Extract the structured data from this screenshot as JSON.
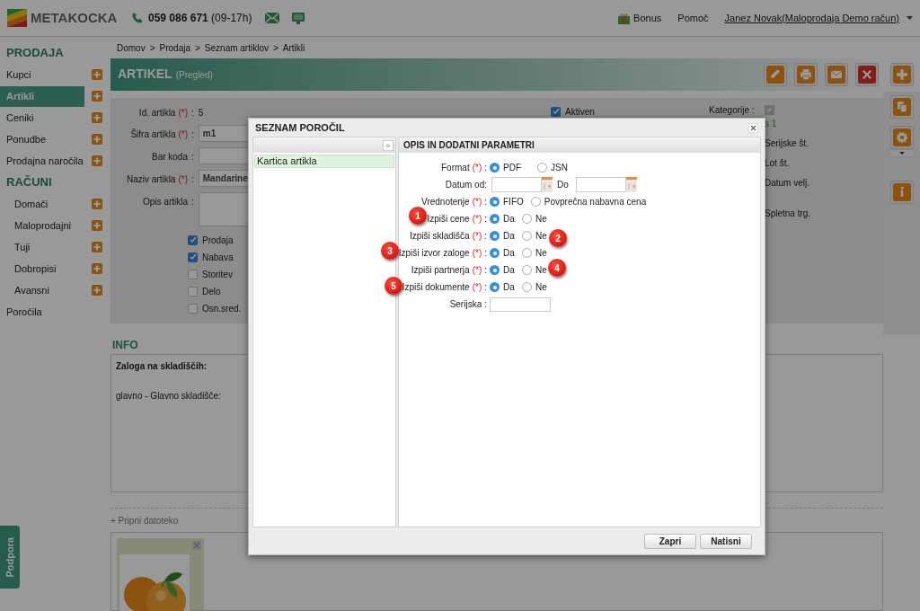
{
  "header": {
    "logo": "METAKOCKA",
    "phone": "**059 086 671** (09-17h)",
    "links": [
      {
        "kind": "bonus",
        "label": "Bonus"
      },
      {
        "kind": "plain",
        "label": "Pomoč"
      },
      {
        "kind": "user",
        "label": "Janez Novak(Maloprodaja Demo račun)"
      }
    ]
  },
  "sidebar": {
    "items": [
      {
        "kind": "heading",
        "label": "PRODAJA"
      },
      {
        "kind": "item",
        "label": "Kupci",
        "selected": false
      },
      {
        "kind": "item",
        "label": "Artikli",
        "selected": true
      },
      {
        "kind": "item",
        "label": "Ceniki",
        "selected": false
      },
      {
        "kind": "item",
        "label": "Ponudbe",
        "selected": false
      },
      {
        "kind": "item",
        "label": "Prodajna naročila",
        "selected": false
      },
      {
        "kind": "heading",
        "label": "RAČUNI"
      },
      {
        "kind": "subitem",
        "label": "Domači",
        "selected": false
      },
      {
        "kind": "subitem",
        "label": "Maloprodajni",
        "selected": false
      },
      {
        "kind": "subitem",
        "label": "Tuji",
        "selected": false
      },
      {
        "kind": "subitem",
        "label": "Dobropisi",
        "selected": false
      },
      {
        "kind": "subitem",
        "label": "Avansni",
        "selected": false
      },
      {
        "kind": "link",
        "label": "Poročila",
        "selected": false
      }
    ]
  },
  "breadcrumb": {
    "separator": ">",
    "items": [
      "Domov",
      "Prodaja",
      "Seznam artiklov",
      "Artikli"
    ]
  },
  "title": {
    "text": "ARTIKEL",
    "subtitle": "(Pregled)"
  },
  "toolbar": [
    {
      "kind": "edit"
    },
    {
      "kind": "print"
    },
    {
      "kind": "mail"
    },
    {
      "kind": "delete"
    }
  ],
  "side_toolbar": [
    {
      "kind": "add"
    },
    {
      "kind": "copy"
    },
    {
      "kind": "settings"
    },
    {
      "kind": "info"
    }
  ],
  "form": {
    "required_mark": "(*)",
    "fields": [
      {
        "kind": "text",
        "label": "Id. artikla",
        "required": true,
        "after": ":",
        "value": "5"
      },
      {
        "kind": "input",
        "label": "Šifra artikla",
        "required": true,
        "after": ":",
        "value": "m1"
      },
      {
        "kind": "input",
        "label": "Bar koda",
        "required": false,
        "after": ":"
      },
      {
        "kind": "input",
        "label": "Naziv artikla",
        "required": true,
        "after": ":",
        "value": "Mandarine"
      },
      {
        "kind": "textarea",
        "label": "Opis artikla",
        "required": false,
        "after": ":"
      }
    ],
    "checkboxes": [
      {
        "label": "Prodaja",
        "checked": true
      },
      {
        "label": "Nabava",
        "checked": true
      },
      {
        "label": "Storitev",
        "checked": false
      },
      {
        "label": "Delo",
        "checked": false
      },
      {
        "label": "Osn.sred.",
        "checked": false
      }
    ],
    "aktiven": {
      "label": "Aktiven",
      "checked": true
    },
    "kategorije": "Kategorije :",
    "kategorija_value": "s 1",
    "extra_labels": [
      "Serijske št.",
      "Lot št.",
      "Datum velj.",
      "Spletna trg."
    ]
  },
  "info": {
    "title": "INFO",
    "heading": "Zaloga na skladiščih:",
    "lines": [
      "glavno - Glavno skladišče:"
    ]
  },
  "attachments": {
    "link": "+ Pripni datoteko"
  },
  "support_tab": "Podpora",
  "dialog": {
    "title": "SEZNAM POROČIL",
    "collapse": "«",
    "reports": [
      {
        "label": "Kartica artikla",
        "selected": true
      }
    ],
    "panel_title": "OPIS IN DODATNI PARAMETRI",
    "required_mark": "(*)",
    "rows": [
      {
        "kind": "radio",
        "label": "Format",
        "required": true,
        "after": ":",
        "options": [
          {
            "label": "PDF",
            "selected": true
          },
          {
            "label": "JSN",
            "selected": false
          }
        ]
      },
      {
        "kind": "date_range",
        "label": "Datum od:",
        "to_label": "Do"
      },
      {
        "kind": "radio",
        "label": "Vrednotenje",
        "required": true,
        "after": ":",
        "options": [
          {
            "label": "FIFO",
            "selected": true
          },
          {
            "label": "Povprečna nabavna cena",
            "selected": false
          }
        ]
      },
      {
        "kind": "radio",
        "label": "Izpiši cene",
        "required": true,
        "after": ":",
        "options": [
          {
            "label": "Da",
            "selected": true
          },
          {
            "label": "Ne",
            "selected": false
          }
        ]
      },
      {
        "kind": "radio",
        "label": "Izpiši skladišča",
        "required": true,
        "after": ":",
        "options": [
          {
            "label": "Da",
            "selected": true
          },
          {
            "label": "Ne",
            "selected": false
          }
        ]
      },
      {
        "kind": "radio",
        "label": "Izpiši izvor zaloge",
        "required": true,
        "after": ":",
        "options": [
          {
            "label": "Da",
            "selected": true
          },
          {
            "label": "Ne",
            "selected": false
          }
        ]
      },
      {
        "kind": "radio",
        "label": "Izpiši partnerja",
        "required": true,
        "after": ":",
        "options": [
          {
            "label": "Da",
            "selected": true
          },
          {
            "label": "Ne",
            "selected": false
          }
        ]
      },
      {
        "kind": "radio",
        "label": "Izpiši dokumente",
        "required": true,
        "after": ":",
        "options": [
          {
            "label": "Da",
            "selected": true
          },
          {
            "label": "Ne",
            "selected": false
          }
        ]
      },
      {
        "kind": "input",
        "label": "Serijska",
        "after": ":"
      }
    ],
    "buttons": [
      "Zapri",
      "Natisni"
    ]
  },
  "callouts": [
    "1",
    "2",
    "3",
    "4",
    "5"
  ]
}
